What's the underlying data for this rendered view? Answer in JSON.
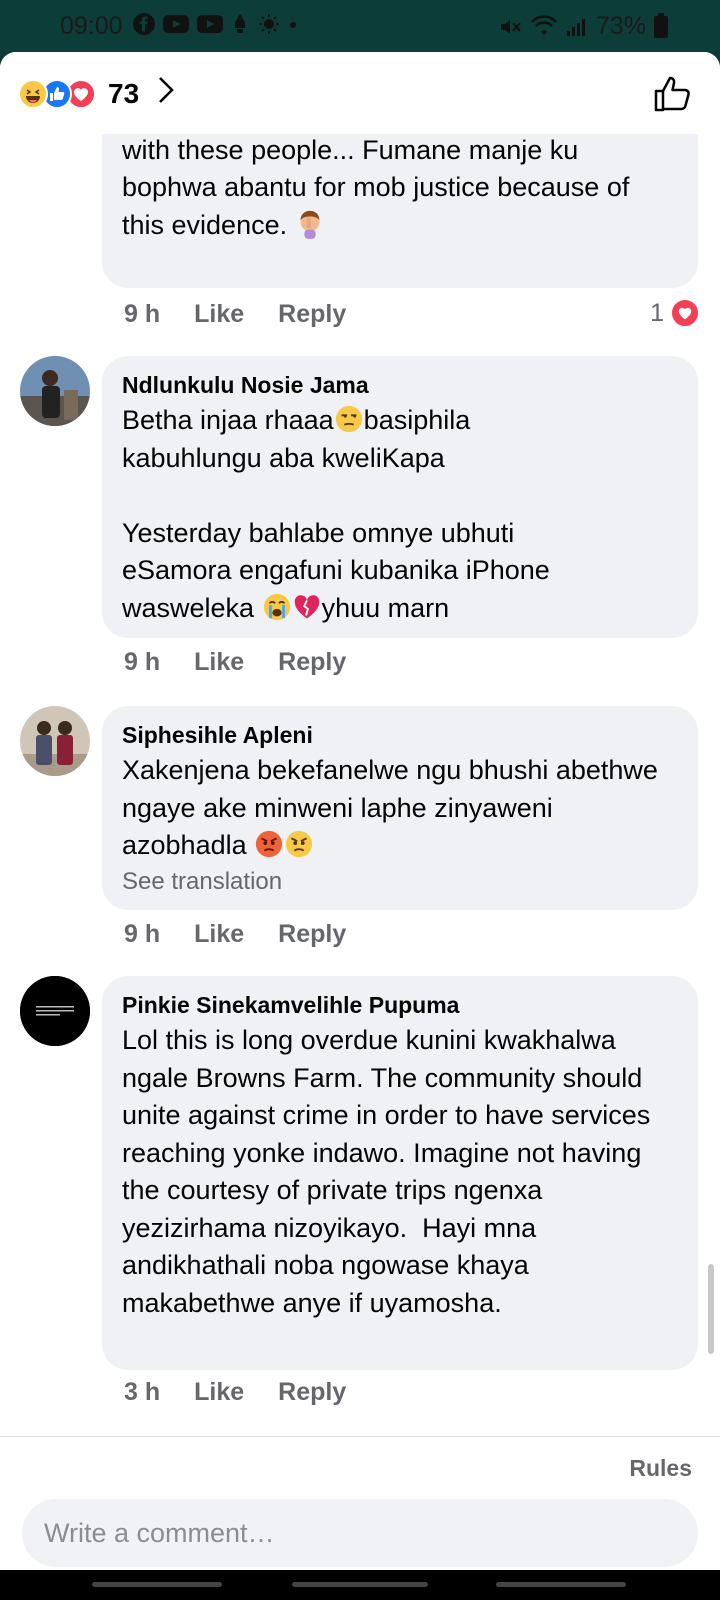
{
  "status": {
    "time": "09:00",
    "battery": "73%",
    "icons_left": [
      "facebook-icon",
      "youtube-icon",
      "youtube-icon",
      "notification-icon",
      "weather-icon",
      "dot-icon"
    ],
    "icons_right": [
      "mute-icon",
      "wifi-icon",
      "signal-icon",
      "battery-charging-icon"
    ]
  },
  "header": {
    "reaction_icons": [
      "haha-icon",
      "like-icon",
      "love-icon"
    ],
    "reaction_count": "73",
    "chevron": "›"
  },
  "comments": [
    {
      "author": "",
      "text": "makushaywa o tsotsi... The police never deal with these people... Fumane manje ku bophwa abantu for mob justice because of this evidence.",
      "emoji": "facepalm-emoji",
      "time": "9 h",
      "like": "Like",
      "reply": "Reply",
      "reaction_count": "1",
      "reaction_icon": "love-icon"
    },
    {
      "author": "Ndlunkulu Nosie Jama",
      "text_parts": [
        "Betha injaa rhaaa",
        "basiphila\nkabuhlungu aba kweliKapa\n\nYesterday bahlabe omnye ubhuti\neSamora engafuni kubanika iPhone\nwasweleka ",
        "yhuu marn"
      ],
      "time": "9 h",
      "like": "Like",
      "reply": "Reply"
    },
    {
      "author": "Siphesihle Apleni",
      "text": "Xakenjena bekefanelwe ngu bhushi abethwe ngaye ake minweni laphe zinyaweni azobhadla",
      "see_translation": "See translation",
      "time": "9 h",
      "like": "Like",
      "reply": "Reply"
    },
    {
      "author": "Pinkie Sinekamvelihle Pupuma",
      "text": "Lol this is long overdue kunini kwakhalwa ngale Browns Farm. The community should unite against crime in order to have services reaching yonke indawo. Imagine not having the courtesy of private trips ngenxa yezizirhama nizoyikayo.  Hayi mna andikhathali noba ngowase khaya makabethwe anye if uyamosha.",
      "time": "3 h",
      "like": "Like",
      "reply": "Reply"
    }
  ],
  "footer": {
    "rules": "Rules",
    "input_placeholder": "Write a comment…"
  },
  "colors": {
    "bubble": "#eff1f4",
    "meta_text": "#65676b",
    "love": "#f33e58",
    "like": "#1877f2",
    "haha": "#f7c948"
  }
}
